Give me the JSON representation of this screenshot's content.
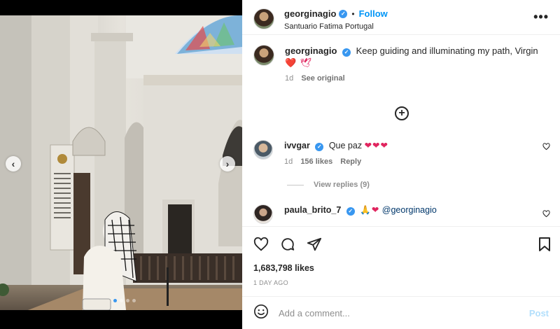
{
  "post": {
    "username": "georginagio",
    "follow_label": "Follow",
    "separator": "•",
    "location": "Santuario Fatima Portugal",
    "more_label": "•••"
  },
  "caption": {
    "username": "georginagio",
    "text": "Keep guiding and illuminating my path, Virgin",
    "emoji": "❤️ 🕊",
    "time": "1d",
    "see_original": "See original"
  },
  "add_comment_icon": "⊕",
  "comments": [
    {
      "username": "ivvgar",
      "text": "Que paz",
      "emoji": "❤❤❤",
      "time": "1d",
      "likes": "156 likes",
      "reply_label": "Reply",
      "view_replies": "View replies (9)"
    },
    {
      "username": "paula_brito_7",
      "emoji": "🙏❤",
      "mention": "@georginagio"
    }
  ],
  "stats": {
    "likes": "1,683,798 likes",
    "date": "1 DAY AGO"
  },
  "comment_box": {
    "placeholder": "Add a comment...",
    "post_label": "Post"
  },
  "carousel": {
    "prev": "‹",
    "next": "›",
    "slide_count": 4,
    "active_index": 0
  },
  "icons": {
    "heart": "heart-icon",
    "comment": "comment-icon",
    "share": "share-icon",
    "bookmark": "bookmark-icon",
    "emoji": "emoji-icon"
  },
  "colors": {
    "accent": "#0095f6",
    "verified": "#3897f0",
    "post_disabled": "#b2dffc",
    "heart": "#e0245e"
  }
}
